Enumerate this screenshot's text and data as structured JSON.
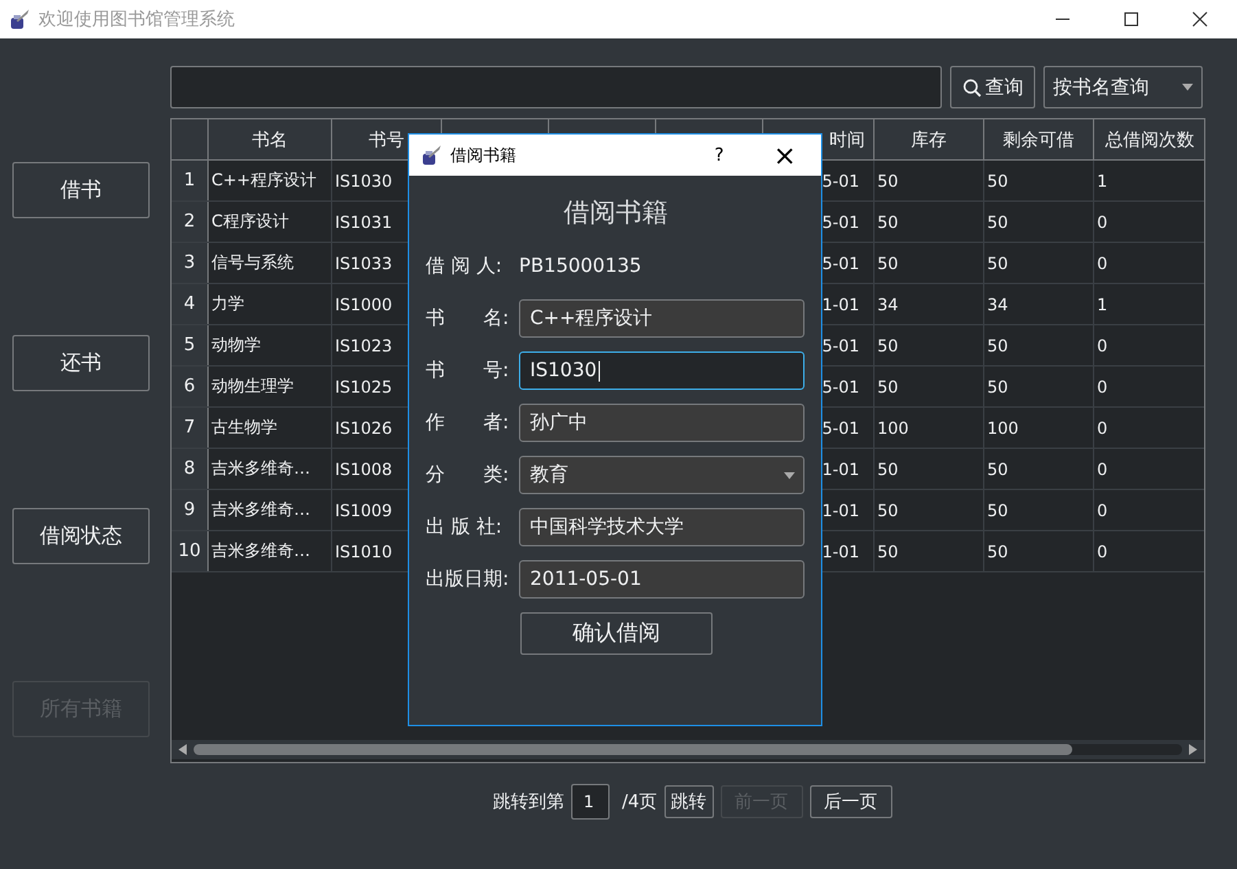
{
  "window": {
    "title": "欢迎使用图书馆管理系统"
  },
  "sidebar": {
    "buttons": [
      {
        "label": "借书",
        "disabled": false
      },
      {
        "label": "还书",
        "disabled": false
      },
      {
        "label": "借阅状态",
        "disabled": false
      },
      {
        "label": "所有书籍",
        "disabled": true
      }
    ]
  },
  "search": {
    "button": "查询",
    "mode": "按书名查询"
  },
  "table": {
    "columns": [
      {
        "kind": "full",
        "label": "书名"
      },
      {
        "kind": "full",
        "label": "书号"
      },
      {
        "kind": "hidden"
      },
      {
        "kind": "hidden"
      },
      {
        "kind": "hidden"
      },
      {
        "kind": "partial",
        "label": "时间"
      },
      {
        "kind": "full",
        "label": "库存"
      },
      {
        "kind": "full",
        "label": "剩余可借"
      },
      {
        "kind": "full",
        "label": "总借阅次数"
      }
    ],
    "rows": [
      {
        "number": "1",
        "cells": [
          "C++程序设计",
          "IS1030",
          null,
          null,
          null,
          "5-01",
          "50",
          "50",
          "1"
        ]
      },
      {
        "number": "2",
        "cells": [
          "C程序设计",
          "IS1031",
          null,
          null,
          null,
          "5-01",
          "50",
          "50",
          "0"
        ]
      },
      {
        "number": "3",
        "cells": [
          "信号与系统",
          "IS1033",
          null,
          null,
          null,
          "5-01",
          "50",
          "50",
          "0"
        ]
      },
      {
        "number": "4",
        "cells": [
          "力学",
          "IS1000",
          null,
          null,
          null,
          "1-01",
          "34",
          "34",
          "1"
        ]
      },
      {
        "number": "5",
        "cells": [
          "动物学",
          "IS1023",
          null,
          null,
          null,
          "5-01",
          "50",
          "50",
          "0"
        ]
      },
      {
        "number": "6",
        "cells": [
          "动物生理学",
          "IS1025",
          null,
          null,
          null,
          "5-01",
          "50",
          "50",
          "0"
        ]
      },
      {
        "number": "7",
        "cells": [
          "古生物学",
          "IS1026",
          null,
          null,
          null,
          "5-01",
          "100",
          "100",
          "0"
        ]
      },
      {
        "number": "8",
        "cells": [
          "吉米多维奇…",
          "IS1008",
          null,
          null,
          null,
          "1-01",
          "50",
          "50",
          "0"
        ]
      },
      {
        "number": "9",
        "cells": [
          "吉米多维奇…",
          "IS1009",
          null,
          null,
          null,
          "1-01",
          "50",
          "50",
          "0"
        ]
      },
      {
        "number": "10",
        "cells": [
          "吉米多维奇…",
          "IS1010",
          null,
          null,
          null,
          "1-01",
          "50",
          "50",
          "0"
        ]
      }
    ]
  },
  "dialog": {
    "title": "借阅书籍",
    "help": "?",
    "close": "×",
    "heading": "借阅书籍",
    "borrower": {
      "label": "借 阅 人:",
      "value": "PB15000135"
    },
    "fields": [
      {
        "kind": "text",
        "label": "书　　名:",
        "value": "C++程序设计",
        "focused": false
      },
      {
        "kind": "text",
        "label": "书　　号:",
        "value": "IS1030",
        "focused": true
      },
      {
        "kind": "text",
        "label": "作　　者:",
        "value": "孙广中",
        "focused": false
      },
      {
        "kind": "select",
        "label": "分　　类:",
        "value": "教育",
        "focused": false
      },
      {
        "kind": "text",
        "label": "出 版 社:",
        "value": "中国科学技术大学",
        "focused": false
      },
      {
        "kind": "text",
        "label": "出版日期:",
        "value": "2011-05-01",
        "focused": false
      }
    ],
    "confirm": "确认借阅"
  },
  "pagination": {
    "prefix": "跳转到第",
    "page": "1",
    "suffix": "/4页",
    "buttons": [
      {
        "label": "跳转",
        "disabled": false
      },
      {
        "label": "前一页",
        "disabled": true
      },
      {
        "label": "后一页",
        "disabled": false
      }
    ]
  }
}
